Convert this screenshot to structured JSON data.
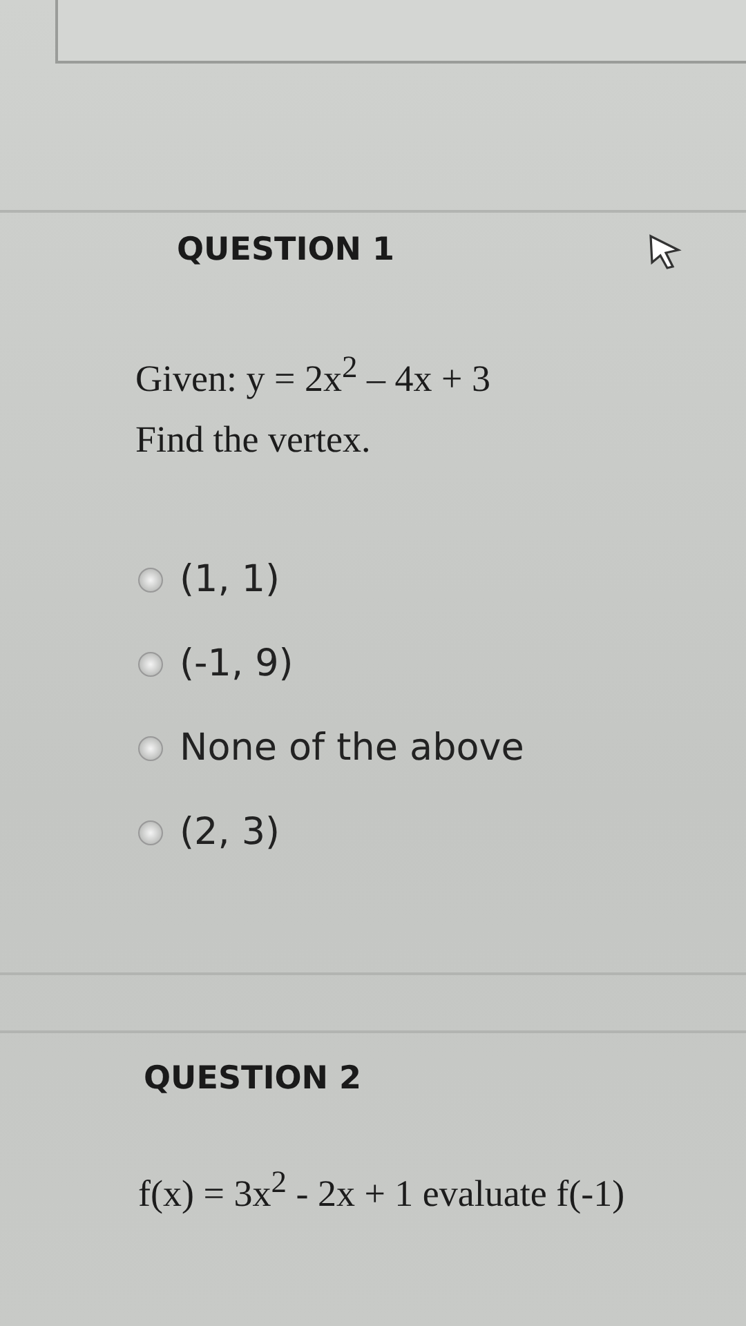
{
  "questions": [
    {
      "title": "QUESTION 1",
      "prompt": [
        "Given:  y = 2x$^{2}$ – 4x + 3",
        "Find the vertex."
      ],
      "options": [
        {
          "label": "(1, 1)",
          "selected": false
        },
        {
          "label": "(-1, 9)",
          "selected": false
        },
        {
          "label": "None of the above",
          "selected": false
        },
        {
          "label": "(2, 3)",
          "selected": false
        }
      ]
    },
    {
      "title": "QUESTION 2",
      "prompt": [
        "f(x) = 3x$^{2}$ - 2x + 1  evaluate f(-1)"
      ]
    }
  ]
}
